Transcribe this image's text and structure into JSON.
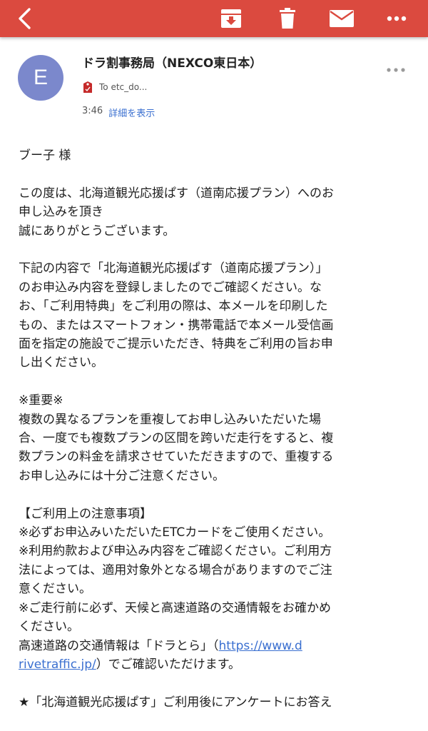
{
  "icons": {
    "back": "chevron-left-icon",
    "archive": "archive-icon",
    "trash": "trash-icon",
    "mail": "mail-icon",
    "more": "more-horizontal-icon",
    "recipient_tag": "important-tag-icon"
  },
  "colors": {
    "toolbar": "#db4a3f",
    "avatar": "#7b88cc",
    "link": "#3a6fd0"
  },
  "email": {
    "avatar_letter": "E",
    "sender": "ドラ割事務局（NEXCO東日本）",
    "recipient": "To etc_do...",
    "time": "3:46",
    "details_label": "詳細を表示"
  },
  "body": {
    "greeting": "ブー子 様",
    "p1": "この度は、北海道観光応援ぱす（道南応援プラン）へのお\n申し込みを頂き\n誠にありがとうございます。",
    "p2": "下記の内容で「北海道観光応援ぱす（道南応援プラン）」\nのお申込み内容を登録しましたのでご確認ください。な\nお、「ご利用特典」をご利用の際は、本メールを印刷した\nもの、またはスマートフォン・携帯電話で本メール受信画\n面を指定の施設でご提示いただき、特典をご利用の旨お申\nし出ください。",
    "p3": "※重要※\n複数の異なるプランを重複してお申し込みいただいた場\n合、一度でも複数プランの区間を跨いだ走行をすると、複\n数プランの料金を請求させていただきますので、重複する\nお申し込みには十分ご注意ください。",
    "p4_heading": "【ご利用上の注意事項】",
    "p4_text": "※必ずお申込みいただいたETCカードをご使用ください。\n※利用約款および申込み内容をご確認ください。ご利用方\n法によっては、適用対象外となる場合がありますのでご注\n意ください。\n※ご走行前に必ず、天候と高速道路の交通情報をお確かめ\nください。\n高速道路の交通情報は「ドラとら」（",
    "link_part1": "https://www.d",
    "link_part2": "rivetraffic.jp/",
    "p4_after_link": "）でご確認いただけます。",
    "p5": "★「北海道観光応援ぱす」ご利用後にアンケートにお答え"
  }
}
